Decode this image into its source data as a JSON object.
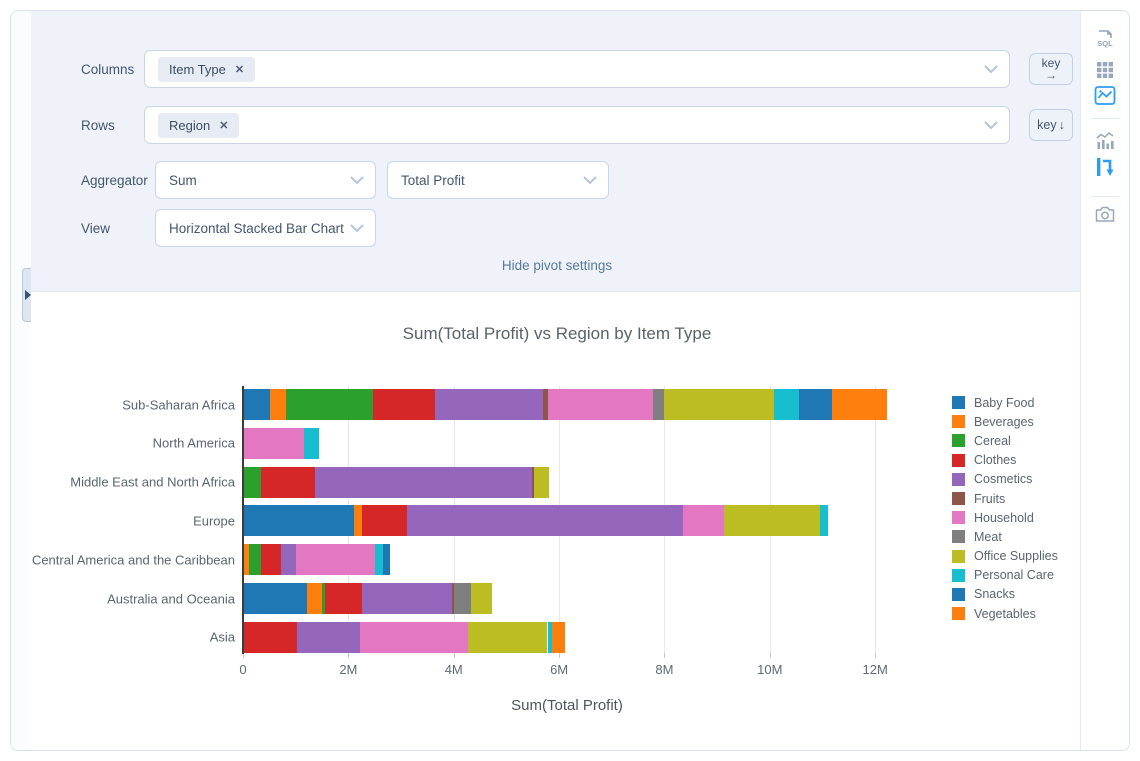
{
  "settings": {
    "columns": {
      "label": "Columns",
      "tag": "Item Type",
      "tag_close": "✕",
      "key_button": {
        "label": "key",
        "arrow": "→"
      }
    },
    "rows": {
      "label": "Rows",
      "tag": "Region",
      "tag_close": "✕",
      "key_button": {
        "label": "key",
        "arrow": "↓"
      }
    },
    "aggregator": {
      "label": "Aggregator",
      "value": "Sum",
      "value2": "Total Profit"
    },
    "view": {
      "label": "View",
      "value": "Horizontal Stacked Bar Chart"
    },
    "hide_link": "Hide pivot settings"
  },
  "sidebar": {
    "icons": [
      {
        "name": "sql-icon",
        "label": "SQL",
        "active": false
      },
      {
        "name": "table-grid-icon",
        "active": false
      },
      {
        "name": "chart-image-icon",
        "active": true
      },
      {
        "name": "stats-chart-icon",
        "active": false
      },
      {
        "name": "pivot-icon",
        "active": true
      },
      {
        "name": "camera-icon",
        "active": false
      }
    ],
    "active_color": "#2d9cf4",
    "inactive_color": "#97a3b7"
  },
  "chart_data": {
    "type": "bar",
    "orientation": "horizontal-stacked",
    "title": "Sum(Total Profit) vs Region by Item Type",
    "xlabel": "Sum(Total Profit)",
    "unit": "millions",
    "xlim_m": [
      0,
      12.3
    ],
    "xticks": [
      {
        "label": "0",
        "value_m": 0
      },
      {
        "label": "2M",
        "value_m": 2
      },
      {
        "label": "4M",
        "value_m": 4
      },
      {
        "label": "6M",
        "value_m": 6
      },
      {
        "label": "8M",
        "value_m": 8
      },
      {
        "label": "10M",
        "value_m": 10
      },
      {
        "label": "12M",
        "value_m": 12
      }
    ],
    "categories": [
      "Sub-Saharan Africa",
      "North America",
      "Middle East and North Africa",
      "Europe",
      "Central America and the Caribbean",
      "Australia and Oceania",
      "Asia"
    ],
    "legend_position": "right",
    "grid": "vertical",
    "series": [
      {
        "name": "Baby Food",
        "color": "#1f77b4",
        "values_m": [
          0.52,
          0,
          0,
          2.1,
          0,
          1.22,
          0
        ]
      },
      {
        "name": "Beverages",
        "color": "#ff7f0e",
        "values_m": [
          0.3,
          0,
          0,
          0.16,
          0.11,
          0.28,
          0
        ]
      },
      {
        "name": "Cereal",
        "color": "#2ca02c",
        "values_m": [
          1.65,
          0,
          0.35,
          0,
          0.24,
          0.06,
          0
        ]
      },
      {
        "name": "Clothes",
        "color": "#d62728",
        "values_m": [
          1.18,
          0,
          1.02,
          0.85,
          0.37,
          0.7,
          1.03
        ]
      },
      {
        "name": "Cosmetics",
        "color": "#9467bd",
        "values_m": [
          2.05,
          0,
          4.11,
          5.25,
          0.29,
          1.7,
          1.2
        ]
      },
      {
        "name": "Fruits",
        "color": "#8c564b",
        "values_m": [
          0.09,
          0,
          0.05,
          0,
          0,
          0.04,
          0
        ]
      },
      {
        "name": "Household",
        "color": "#e377c2",
        "values_m": [
          2.0,
          1.15,
          0,
          0.77,
          1.5,
          0,
          2.05
        ]
      },
      {
        "name": "Meat",
        "color": "#7f7f7f",
        "values_m": [
          0.2,
          0,
          0,
          0,
          0,
          0.33,
          0
        ]
      },
      {
        "name": "Office Supplies",
        "color": "#bcbd22",
        "values_m": [
          2.08,
          0,
          0.28,
          1.82,
          0,
          0.4,
          1.5
        ]
      },
      {
        "name": "Personal Care",
        "color": "#17becf",
        "values_m": [
          0.49,
          0.3,
          0,
          0.15,
          0.15,
          0,
          0.08
        ]
      },
      {
        "name": "Snacks",
        "color": "#1f77b4",
        "values_m": [
          0.62,
          0,
          0,
          0,
          0.13,
          0,
          0
        ]
      },
      {
        "name": "Vegetables",
        "color": "#ff7f0e",
        "values_m": [
          1.04,
          0,
          0,
          0,
          0,
          0,
          0.25
        ]
      }
    ]
  }
}
